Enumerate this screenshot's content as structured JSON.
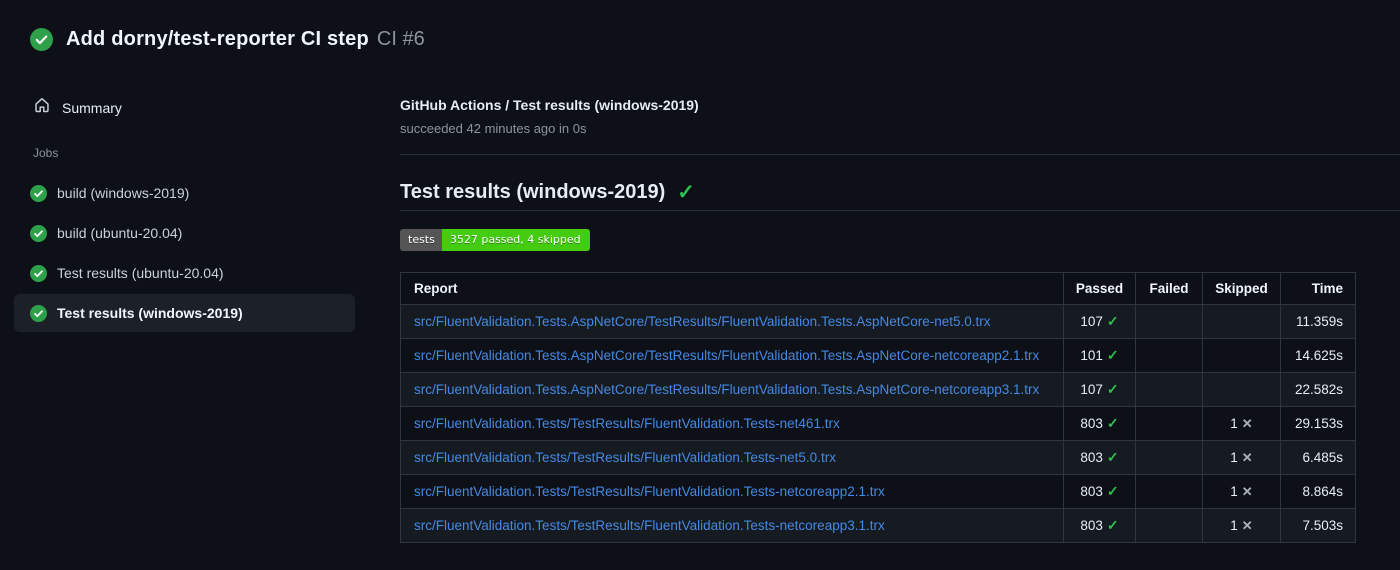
{
  "header": {
    "title": "Add dorny/test-reporter CI step",
    "run_number": "CI #6",
    "status_icon": "check-circle-icon"
  },
  "sidebar": {
    "summary_label": "Summary",
    "jobs_label": "Jobs",
    "jobs": [
      {
        "label": "build (windows-2019)",
        "selected": false
      },
      {
        "label": "build (ubuntu-20.04)",
        "selected": false
      },
      {
        "label": "Test results (ubuntu-20.04)",
        "selected": false
      },
      {
        "label": "Test results (windows-2019)",
        "selected": true
      }
    ]
  },
  "main": {
    "check_title": "GitHub Actions / Test results (windows-2019)",
    "check_status": "succeeded 42 minutes ago in 0s",
    "section_title": "Test results (windows-2019)",
    "section_check_icon": "check-icon",
    "badge": {
      "label": "tests",
      "value": "3527 passed, 4 skipped",
      "label_bg": "#555555",
      "value_bg": "#44cc11"
    },
    "table": {
      "headers": [
        "Report",
        "Passed",
        "Failed",
        "Skipped",
        "Time"
      ],
      "rows": [
        {
          "report": "src/FluentValidation.Tests.AspNetCore/TestResults/FluentValidation.Tests.AspNetCore-net5.0.trx",
          "passed": "107",
          "failed": "",
          "skipped": "",
          "time": "11.359s"
        },
        {
          "report": "src/FluentValidation.Tests.AspNetCore/TestResults/FluentValidation.Tests.AspNetCore-netcoreapp2.1.trx",
          "passed": "101",
          "failed": "",
          "skipped": "",
          "time": "14.625s"
        },
        {
          "report": "src/FluentValidation.Tests.AspNetCore/TestResults/FluentValidation.Tests.AspNetCore-netcoreapp3.1.trx",
          "passed": "107",
          "failed": "",
          "skipped": "",
          "time": "22.582s"
        },
        {
          "report": "src/FluentValidation.Tests/TestResults/FluentValidation.Tests-net461.trx",
          "passed": "803",
          "failed": "",
          "skipped": "1",
          "time": "29.153s"
        },
        {
          "report": "src/FluentValidation.Tests/TestResults/FluentValidation.Tests-net5.0.trx",
          "passed": "803",
          "failed": "",
          "skipped": "1",
          "time": "6.485s"
        },
        {
          "report": "src/FluentValidation.Tests/TestResults/FluentValidation.Tests-netcoreapp2.1.trx",
          "passed": "803",
          "failed": "",
          "skipped": "1",
          "time": "8.864s"
        },
        {
          "report": "src/FluentValidation.Tests/TestResults/FluentValidation.Tests-netcoreapp3.1.trx",
          "passed": "803",
          "failed": "",
          "skipped": "1",
          "time": "7.503s"
        }
      ]
    }
  },
  "colors": {
    "page_bg": "#0d1117",
    "row_alt_bg": "#161b22",
    "selected_job_bg": "#1c2128",
    "border": "#30363d",
    "success_green": "#2ebf4f",
    "icon_circle_green": "#2ea04a",
    "link_blue": "#4489e4",
    "secondary_text": "#8b949e"
  }
}
